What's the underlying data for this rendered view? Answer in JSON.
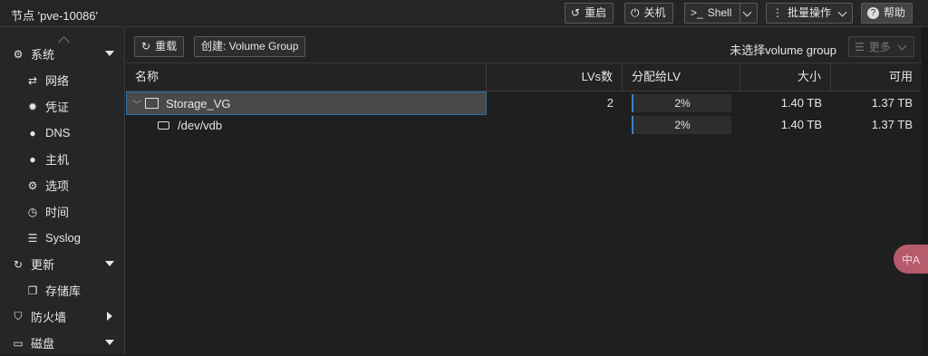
{
  "window": {
    "title": "节点 'pve-10086'"
  },
  "top_buttons": {
    "reboot": "重启",
    "shutdown": "关机",
    "shell": "Shell",
    "bulk": "批量操作",
    "help": "帮助"
  },
  "sidebar": {
    "items": [
      {
        "label": "系统",
        "icon": "gears-icon"
      },
      {
        "label": "网络",
        "icon": "network-icon"
      },
      {
        "label": "凭证",
        "icon": "certificate-icon"
      },
      {
        "label": "DNS",
        "icon": "globe-icon"
      },
      {
        "label": "主机",
        "icon": "globe-icon"
      },
      {
        "label": "选项",
        "icon": "gear-icon"
      },
      {
        "label": "时间",
        "icon": "clock-icon"
      },
      {
        "label": "Syslog",
        "icon": "list-icon"
      },
      {
        "label": "更新",
        "icon": "refresh-icon"
      },
      {
        "label": "存储库",
        "icon": "files-icon"
      },
      {
        "label": "防火墙",
        "icon": "shield-icon"
      },
      {
        "label": "磁盘",
        "icon": "drive-icon"
      }
    ]
  },
  "toolbar": {
    "reload": "重载",
    "create": "创建: Volume Group",
    "no_selection": "未选择volume group",
    "more": "更多"
  },
  "table": {
    "headers": {
      "name": "名称",
      "lvs": "LVs数",
      "assigned": "分配给LV",
      "size": "大小",
      "free": "可用"
    },
    "rows": [
      {
        "name": "Storage_VG",
        "lvs": "2",
        "assigned": "2%",
        "size": "1.40 TB",
        "free": "1.37 TB"
      },
      {
        "name": "/dev/vdb",
        "lvs": "",
        "assigned": "2%",
        "size": "1.40 TB",
        "free": "1.37 TB"
      }
    ]
  },
  "translate_button": {
    "label": "中A"
  },
  "colors": {
    "background": "#1f1f1f",
    "accent": "#3b82c4",
    "fab": "#b65a6c"
  }
}
